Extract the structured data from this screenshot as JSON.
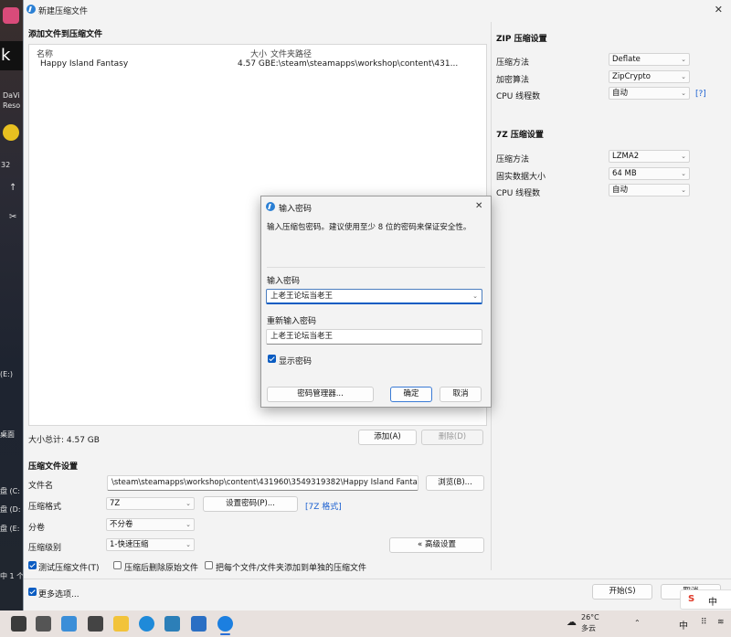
{
  "window": {
    "title": "新建压缩文件",
    "close_glyph": "✕"
  },
  "desktop": {
    "k_label": "k",
    "items": [
      "DaVi",
      "Reso",
      "32",
      "(E:)",
      "桌面",
      "盘 (C:",
      "盘 (D:",
      "盘 (E:",
      "中 1 个"
    ]
  },
  "add_section": {
    "title": "添加文件到压缩文件"
  },
  "file_list": {
    "columns": [
      "名称",
      "大小",
      "文件夹路径"
    ],
    "rows": [
      {
        "name": "Happy Island Fantasy",
        "size": "4.57 GB",
        "path": "E:\\steam\\steamapps\\workshop\\content\\431..."
      }
    ]
  },
  "totals": {
    "label": "大小总计: 4.57 GB"
  },
  "buttons": {
    "add": "添加(A)",
    "delete": "删除(D)",
    "browse": "浏览(B)...",
    "set_password": "设置密码(P)...",
    "advanced": "« 高级设置",
    "start": "开始(S)",
    "cancel": "取消"
  },
  "compress_settings": {
    "title": "压缩文件设置",
    "filename_label": "文件名",
    "filename_value": "\\steam\\steamapps\\workshop\\content\\431960\\3549319382\\Happy Island Fantasy.7z",
    "format_label": "压缩格式",
    "format_value": "7Z",
    "format_link": "[7Z 格式]",
    "split_label": "分卷",
    "split_value": "不分卷",
    "level_label": "压缩级别",
    "level_value": "1-快速压缩",
    "opt_test": "测试压缩文件(T)",
    "opt_delete": "压缩后删除原始文件",
    "opt_separate": "把每个文件/文件夹添加到单独的压缩文件",
    "more_options": "更多选项..."
  },
  "zip_settings": {
    "title": "ZIP 压缩设置",
    "method_label": "压缩方法",
    "method_value": "Deflate",
    "encrypt_label": "加密算法",
    "encrypt_value": "ZipCrypto",
    "cpu_label": "CPU 线程数",
    "cpu_value": "自动",
    "help": "[?]"
  },
  "sevenz_settings": {
    "title": "7Z 压缩设置",
    "method_label": "压缩方法",
    "method_value": "LZMA2",
    "block_label": "固实数据大小",
    "block_value": "64 MB",
    "cpu_label": "CPU 线程数",
    "cpu_value": "自动"
  },
  "dialog": {
    "title": "输入密码",
    "close_glyph": "✕",
    "hint": "输入压缩包密码。建议使用至少 8 位的密码来保证安全性。",
    "pw_label": "输入密码",
    "pw_value": "上老王论坛当老王",
    "pw2_label": "重新输入密码",
    "pw2_value": "上老王论坛当老王",
    "show_pw": "显示密码",
    "manager": "密码管理器...",
    "ok": "确定",
    "cancel": "取消"
  },
  "taskbar": {
    "weather_temp": "26°C",
    "weather_desc": "多云",
    "lang": "中",
    "ime_s": "S",
    "ime_lang": "中"
  }
}
